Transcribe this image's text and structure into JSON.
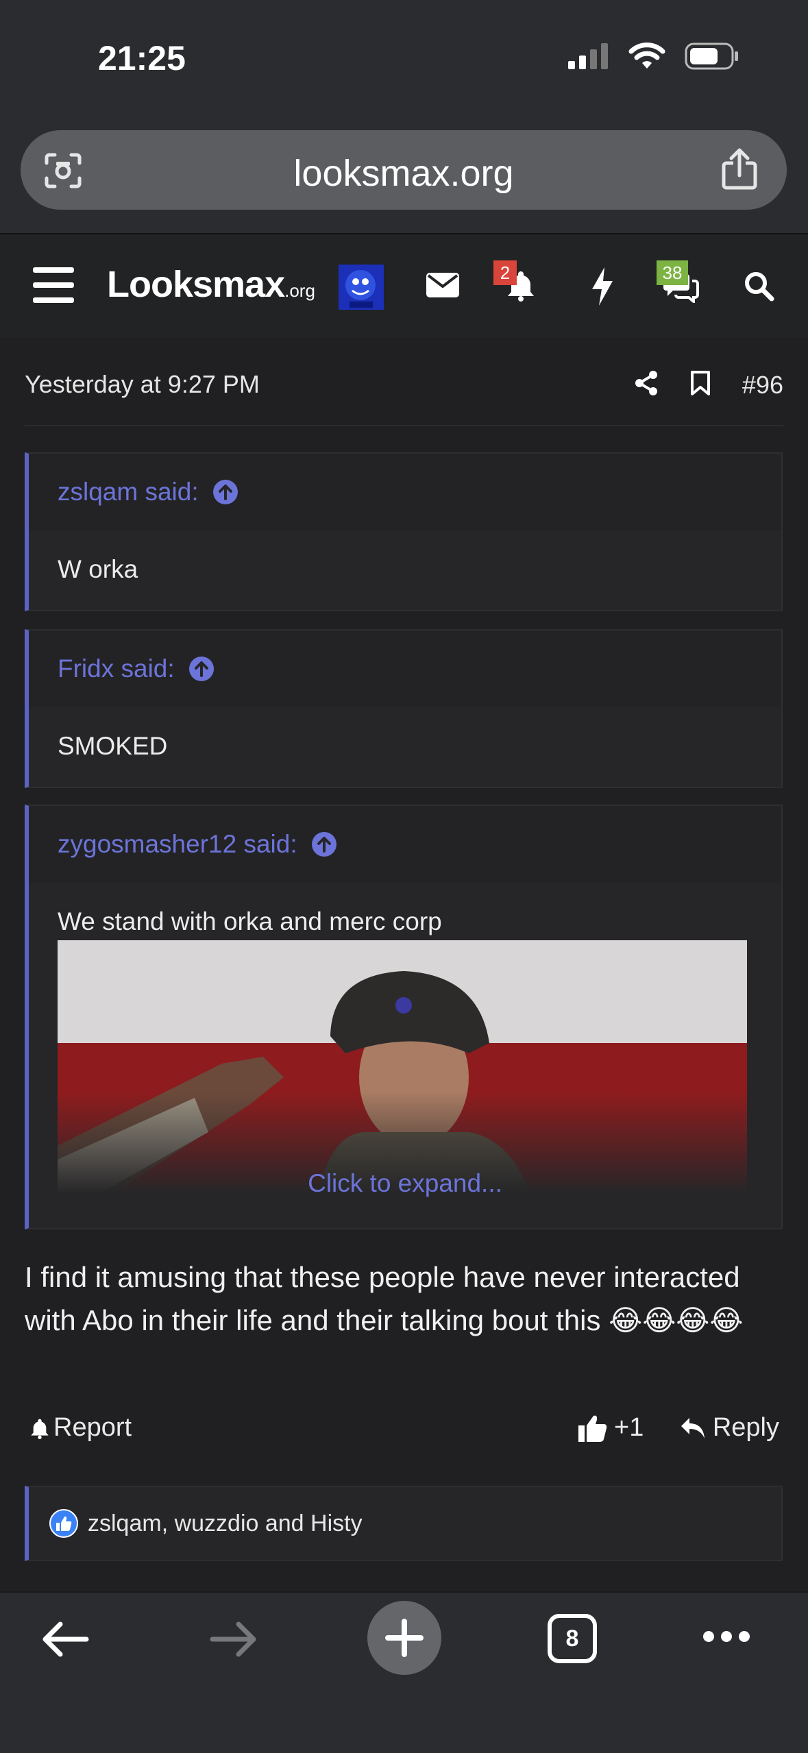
{
  "status_bar": {
    "time": "21:25"
  },
  "browser": {
    "url": "looksmax.org",
    "tab_count": "8"
  },
  "nav": {
    "logo_text": "Looksmax",
    "logo_suffix": ".org",
    "alerts_count": "2",
    "conversations_count": "38",
    "accent_badge_red": "#d9443b",
    "accent_badge_green": "#7cb342"
  },
  "post": {
    "date": "Yesterday at 9:27 PM",
    "number": "#96",
    "quotes": [
      {
        "author": "zslqam said:",
        "text": "W orka"
      },
      {
        "author": "Fridx said:",
        "text": "SMOKED"
      },
      {
        "author": "zygosmasher12 said:",
        "text": "We stand with orka and merc corp",
        "expand": "Click to expand..."
      }
    ],
    "body": "I find it amusing that these people have never interacted with Abo in their life and their talking bout this 😂😂😂😂",
    "report_label": "Report",
    "like_count": "+1",
    "reply_label": "Reply",
    "reactions_text": "zslqam, wuzzdio and Histy"
  },
  "colors": {
    "accent": "#6c74d9",
    "quote_border": "#5c63c5",
    "like_blue": "#3b82f6"
  }
}
